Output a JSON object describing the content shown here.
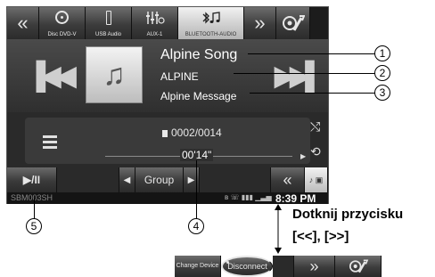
{
  "top_bar": {
    "prev_icon": "double-chevron-left-icon",
    "sources": [
      {
        "label": "Disc DVD-V",
        "icon": "disc-icon"
      },
      {
        "label": "USB Audio",
        "icon": "usb-icon"
      },
      {
        "label": "AUX-1",
        "icon": "aux-icon"
      },
      {
        "label": "BLUETOOTH-AUDIO",
        "icon": "bluetooth-audio-icon",
        "active": true
      }
    ],
    "next_icon": "double-chevron-right-icon",
    "setup_icon": "setup-icon"
  },
  "info": {
    "song": "Alpine Song",
    "artist": "ALPINE",
    "album": "Alpine Message"
  },
  "track": {
    "number": "0002/0014",
    "elapsed": "00'14\""
  },
  "bottom_bar": {
    "play_pause": "▶/II",
    "group": "Group",
    "more": "«"
  },
  "status": {
    "device": "SBM003SH",
    "clock": "8:39 PM"
  },
  "callouts": [
    "1",
    "2",
    "3",
    "4",
    "5"
  ],
  "note": {
    "line1": "Dotknij przycisku",
    "line2": "[<<], [>>]"
  },
  "lower_bar": {
    "change_device": "Change Device",
    "disconnect": "Disconnect",
    "more": "»"
  },
  "colors": {
    "screen_bg": "#1c1c1c",
    "button_dark": "#3c3c3c",
    "button_active": "#cfcfcf",
    "text": "#ffffff"
  }
}
